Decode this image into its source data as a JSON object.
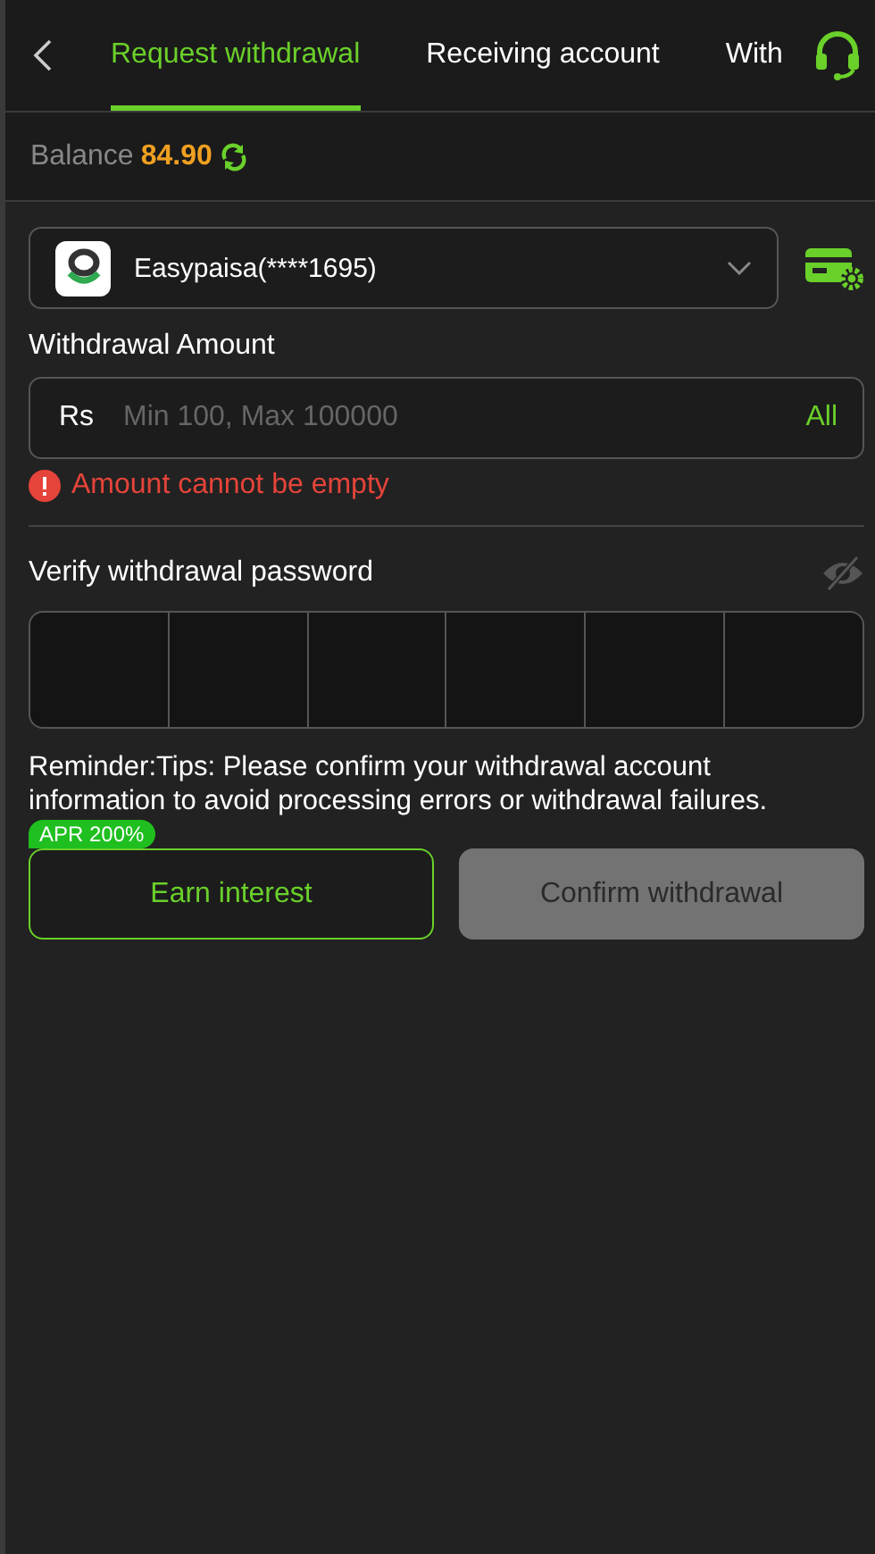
{
  "tabs": [
    {
      "label": "Request withdrawal",
      "selected": true
    },
    {
      "label": "Receiving account",
      "selected": false
    },
    {
      "label": "With",
      "selected": false
    }
  ],
  "balance": {
    "label": "Balance",
    "amount": "84.90"
  },
  "account": {
    "name": "Easypaisa(****1695)"
  },
  "amount": {
    "label": "Withdrawal Amount",
    "currency": "Rs",
    "placeholder": "Min 100, Max 100000",
    "all": "All",
    "error": "Amount cannot be empty"
  },
  "password": {
    "label": "Verify withdrawal password",
    "visible": false
  },
  "reminder": "Reminder:Tips: Please confirm your withdrawal account information to avoid processing errors or withdrawal failures.",
  "buttons": [
    {
      "kind": "outline",
      "label": "Earn interest",
      "badge": "APR 200%",
      "disabled": false
    },
    {
      "kind": "primary",
      "label": "Confirm withdrawal",
      "disabled": true
    }
  ]
}
